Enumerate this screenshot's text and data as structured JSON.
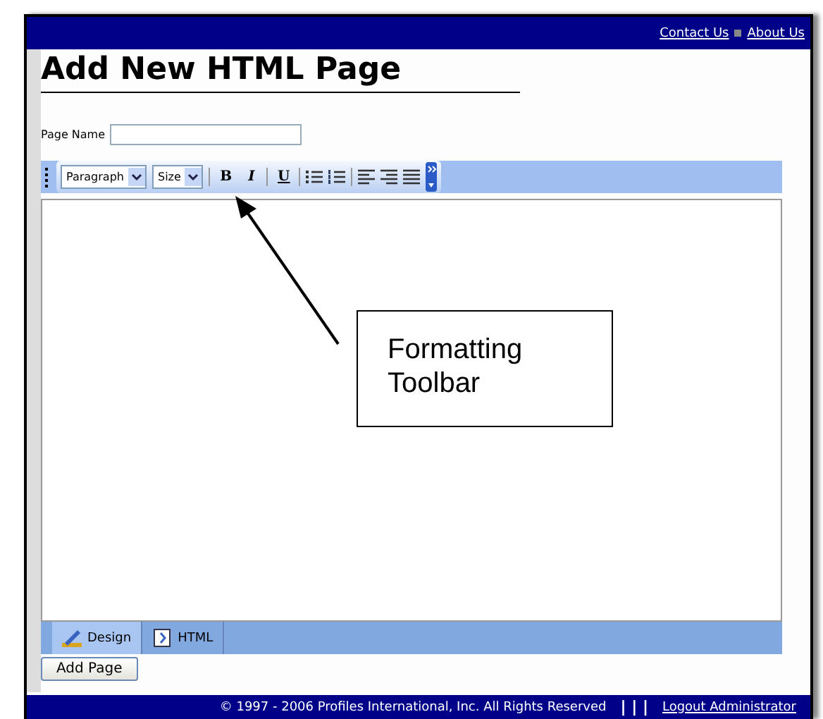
{
  "header": {
    "links": [
      "Contact Us",
      "About Us"
    ]
  },
  "title": "Add New HTML Page",
  "page_name": {
    "label": "Page Name"
  },
  "toolbar": {
    "dropdowns": [
      "Paragraph",
      "Size"
    ],
    "buttons": [
      {
        "kind": "bold",
        "label": "B"
      },
      {
        "kind": "italic",
        "label": "I"
      },
      {
        "kind": "underline",
        "label": "U"
      },
      {
        "kind": "bullets"
      },
      {
        "kind": "numbers"
      },
      {
        "kind": "align-left"
      },
      {
        "kind": "align-right"
      },
      {
        "kind": "justify"
      }
    ]
  },
  "tabs": [
    {
      "label": "Design",
      "kind": "design",
      "selected": true
    },
    {
      "label": "HTML",
      "kind": "html",
      "selected": false
    }
  ],
  "submit": "Add Page",
  "footer": {
    "copyright": "© 1997 - 2006 Profiles International, Inc. All Rights Reserved",
    "separator": "| | |",
    "link": "Logout Administrator"
  },
  "callout": {
    "text": "Formatting Toolbar"
  }
}
